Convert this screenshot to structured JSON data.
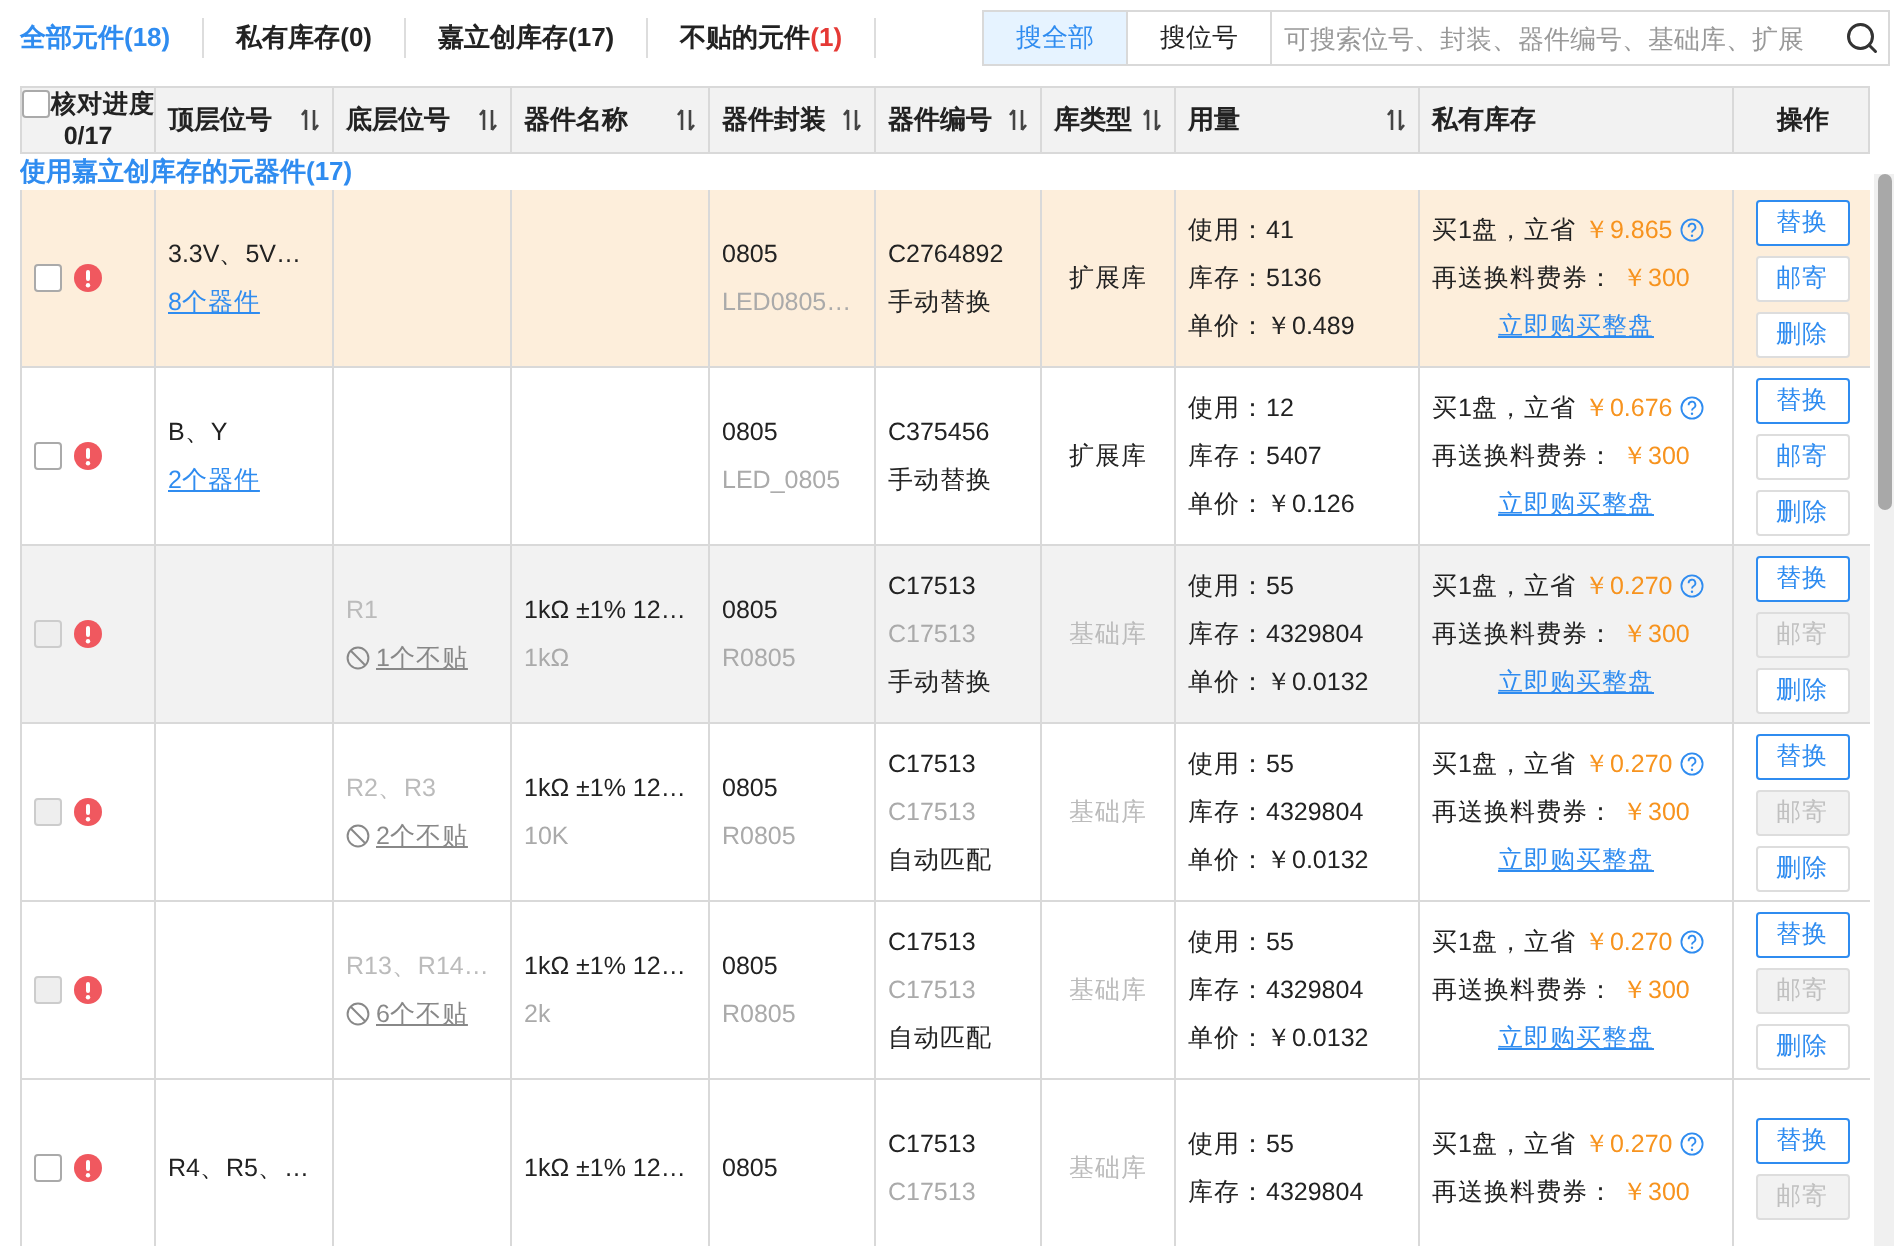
{
  "tabs": [
    {
      "label": "全部元件",
      "count": "(18)",
      "selected": true,
      "alert": false
    },
    {
      "label": "私有库存",
      "count": "(0)",
      "selected": false,
      "alert": false
    },
    {
      "label": "嘉立创库存",
      "count": "(17)",
      "selected": false,
      "alert": false
    },
    {
      "label": "不贴的元件",
      "count": "(1)",
      "selected": false,
      "alert": true
    }
  ],
  "search": {
    "modes": [
      {
        "label": "搜全部",
        "selected": true
      },
      {
        "label": "搜位号",
        "selected": false
      }
    ],
    "placeholder": "可搜索位号、封装、器件编号、基础库、扩展"
  },
  "table": {
    "progress": {
      "label": "核对进度",
      "value": "0/17",
      "checked": false
    },
    "columns": [
      {
        "label": "顶层位号",
        "sortable": true
      },
      {
        "label": "底层位号",
        "sortable": true
      },
      {
        "label": "器件名称",
        "sortable": true
      },
      {
        "label": "器件封装",
        "sortable": true
      },
      {
        "label": "器件编号",
        "sortable": true
      },
      {
        "label": "库类型",
        "sortable": true
      },
      {
        "label": "用量",
        "sortable": true
      },
      {
        "label": "私有库存",
        "sortable": false
      },
      {
        "label": "操作",
        "sortable": false
      }
    ],
    "section": "使用嘉立创库存的元器件(17)",
    "rows": [
      {
        "checked": false,
        "disabled": false,
        "highlighted": true,
        "shaded": false,
        "top": "3.3V、5V…",
        "top_link": "8个器件",
        "package": "0805",
        "package_sub": "LED0805…",
        "part_no": "C2764892",
        "match": "手动替换",
        "library": {
          "label": "扩展库",
          "muted": false
        },
        "usage": [
          "使用：41",
          "库存：5136",
          "单价：￥0.489"
        ],
        "saving_label": "买1盘，立省",
        "saving": "￥9.865",
        "coupon_label": "再送换料费券：",
        "coupon": "￥300",
        "buy_link": "立即购买整盘",
        "buttons": [
          {
            "label": "替换",
            "kind": "primary",
            "disabled": false
          },
          {
            "label": "邮寄",
            "kind": "plain",
            "disabled": false
          },
          {
            "label": "删除",
            "kind": "plain",
            "disabled": false
          }
        ]
      },
      {
        "checked": false,
        "disabled": false,
        "highlighted": false,
        "shaded": false,
        "top": "B、Y",
        "top_link": "2个器件",
        "package": "0805",
        "package_sub": "LED_0805",
        "part_no": "C375456",
        "match": "手动替换",
        "library": {
          "label": "扩展库",
          "muted": false
        },
        "usage": [
          "使用：12",
          "库存：5407",
          "单价：￥0.126"
        ],
        "saving_label": "买1盘，立省",
        "saving": "￥0.676",
        "coupon_label": "再送换料费券：",
        "coupon": "￥300",
        "buy_link": "立即购买整盘",
        "buttons": [
          {
            "label": "替换",
            "kind": "primary",
            "disabled": false
          },
          {
            "label": "邮寄",
            "kind": "plain",
            "disabled": false
          },
          {
            "label": "删除",
            "kind": "plain",
            "disabled": false
          }
        ]
      },
      {
        "checked": false,
        "disabled": true,
        "highlighted": false,
        "shaded": true,
        "bottom": "R1",
        "bottom_link": "1个不贴",
        "name": "1kΩ ±1% 12…",
        "name_sub": "1kΩ",
        "package": "0805",
        "package_sub": "R0805",
        "part_no": "C17513",
        "part_no_sub": "C17513",
        "match": "手动替换",
        "library": {
          "label": "基础库",
          "muted": true
        },
        "usage": [
          "使用：55",
          "库存：4329804",
          "单价：￥0.0132"
        ],
        "saving_label": "买1盘，立省",
        "saving": "￥0.270",
        "coupon_label": "再送换料费券：",
        "coupon": "￥300",
        "buy_link": "立即购买整盘",
        "buttons": [
          {
            "label": "替换",
            "kind": "primary",
            "disabled": false
          },
          {
            "label": "邮寄",
            "kind": "plain",
            "disabled": true
          },
          {
            "label": "删除",
            "kind": "plain",
            "disabled": false
          }
        ]
      },
      {
        "checked": false,
        "disabled": true,
        "highlighted": false,
        "shaded": false,
        "bottom": "R2、R3",
        "bottom_link": "2个不贴",
        "name": "1kΩ ±1% 12…",
        "name_sub": "10K",
        "package": "0805",
        "package_sub": "R0805",
        "part_no": "C17513",
        "part_no_sub": "C17513",
        "match": "自动匹配",
        "library": {
          "label": "基础库",
          "muted": true
        },
        "usage": [
          "使用：55",
          "库存：4329804",
          "单价：￥0.0132"
        ],
        "saving_label": "买1盘，立省",
        "saving": "￥0.270",
        "coupon_label": "再送换料费券：",
        "coupon": "￥300",
        "buy_link": "立即购买整盘",
        "buttons": [
          {
            "label": "替换",
            "kind": "primary",
            "disabled": false
          },
          {
            "label": "邮寄",
            "kind": "plain",
            "disabled": true
          },
          {
            "label": "删除",
            "kind": "plain",
            "disabled": false
          }
        ]
      },
      {
        "checked": false,
        "disabled": true,
        "highlighted": false,
        "shaded": false,
        "bottom": "R13、R14…",
        "bottom_link": "6个不贴",
        "name": "1kΩ ±1% 12…",
        "name_sub": "2k",
        "package": "0805",
        "package_sub": "R0805",
        "part_no": "C17513",
        "part_no_sub": "C17513",
        "match": "自动匹配",
        "library": {
          "label": "基础库",
          "muted": true
        },
        "usage": [
          "使用：55",
          "库存：4329804",
          "单价：￥0.0132"
        ],
        "saving_label": "买1盘，立省",
        "saving": "￥0.270",
        "coupon_label": "再送换料费券：",
        "coupon": "￥300",
        "buy_link": "立即购买整盘",
        "buttons": [
          {
            "label": "替换",
            "kind": "primary",
            "disabled": false
          },
          {
            "label": "邮寄",
            "kind": "plain",
            "disabled": true
          },
          {
            "label": "删除",
            "kind": "plain",
            "disabled": false
          }
        ]
      },
      {
        "checked": false,
        "disabled": false,
        "highlighted": false,
        "shaded": false,
        "top": "R4、R5、…",
        "name": "1kΩ ±1% 12…",
        "package": "0805",
        "part_no": "C17513",
        "part_no_sub": "C17513",
        "library": {
          "label": "基础库",
          "muted": true
        },
        "usage": [
          "使用：55",
          "库存：4329804"
        ],
        "saving_label": "买1盘，立省",
        "saving": "￥0.270",
        "coupon_label": "再送换料费券：",
        "coupon": "￥300",
        "buttons": [
          {
            "label": "替换",
            "kind": "primary",
            "disabled": false
          },
          {
            "label": "邮寄",
            "kind": "plain",
            "disabled": true
          }
        ]
      }
    ]
  }
}
